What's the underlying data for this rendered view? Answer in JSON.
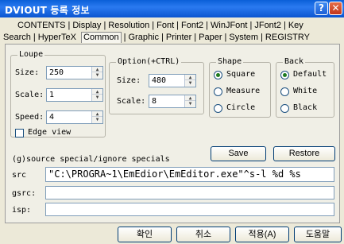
{
  "window": {
    "title": "DVIOUT 등록 정보",
    "help_icon": "?",
    "close_icon": "✕"
  },
  "tabs": {
    "row1": [
      "CONTENTS",
      "Display",
      "Resolution",
      "Font",
      "Font2",
      "WinJFont",
      "JFont2",
      "Key"
    ],
    "row2": [
      "Search",
      "HyperTeX",
      "Common",
      "Graphic",
      "Printer",
      "Paper",
      "System",
      "REGISTRY"
    ],
    "active": "Common"
  },
  "loupe": {
    "legend": "Loupe",
    "size_label": "Size:",
    "size_value": "250",
    "scale_label": "Scale:",
    "scale_value": "1",
    "speed_label": "Speed:",
    "speed_value": "4",
    "edge_view_label": "Edge view",
    "edge_view_checked": false
  },
  "option": {
    "legend": "Option(+CTRL)",
    "size_label": "Size:",
    "size_value": "480",
    "scale_label": "Scale:",
    "scale_value": "8"
  },
  "shape": {
    "legend": "Shape",
    "options": [
      "Square",
      "Measure",
      "Circle"
    ],
    "selected": "Square"
  },
  "back": {
    "legend": "Back",
    "options": [
      "Default",
      "White",
      "Black"
    ],
    "selected": "Default"
  },
  "specials": {
    "label": "(g)source special/ignore specials",
    "save_label": "Save",
    "restore_label": "Restore"
  },
  "fields": {
    "src_label": "src",
    "src_value": "\"C:\\PROGRA~1\\EmEdior\\EmEditor.exe\"^s-l %d %s",
    "gsrc_label": "gsrc:",
    "gsrc_value": "",
    "isp_label": "isp:",
    "isp_value": ""
  },
  "footer": {
    "ok": "확인",
    "cancel": "취소",
    "apply": "적용(A)",
    "help": "도움말"
  }
}
